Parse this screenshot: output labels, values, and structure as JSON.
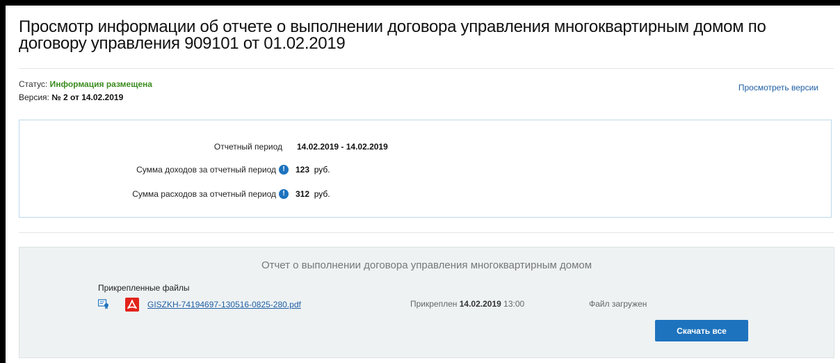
{
  "page": {
    "title": "Просмотр информации об отчете о выполнении договора управления многоквартирным домом по договору управления 909101 от 01.02.2019"
  },
  "status": {
    "label": "Статус:",
    "value": "Информация размещена",
    "value_color": "#3a8c1e"
  },
  "version": {
    "label": "Версия:",
    "value": "№ 2 от 14.02.2019"
  },
  "versions_link": "Просмотреть версии",
  "info": {
    "period": {
      "label": "Отчетный период",
      "value": "14.02.2019 - 14.02.2019"
    },
    "income": {
      "label": "Сумма доходов за отчетный период",
      "value": "123",
      "unit": "руб."
    },
    "expenses": {
      "label": "Сумма расходов за отчетный период",
      "value": "312",
      "unit": "руб."
    }
  },
  "report": {
    "title": "Отчет о выполнении договора управления многоквартирным домом",
    "attached_label": "Прикрепленные файлы",
    "files": [
      {
        "name": "GISZKH-74194697-130516-0825-280.pdf",
        "attached_prefix": "Прикреплен",
        "attached_date": "14.02.2019",
        "attached_time": "13:00",
        "status": "Файл загружен",
        "icons": [
          "signature-icon",
          "pdf-icon"
        ]
      }
    ],
    "download_all": "Скачать все"
  },
  "colors": {
    "accent": "#1e73be",
    "link": "#1f5fa5",
    "panel_bg": "#eef2f3",
    "box_border": "#bcd8ea",
    "pdf": "#e2231a"
  }
}
